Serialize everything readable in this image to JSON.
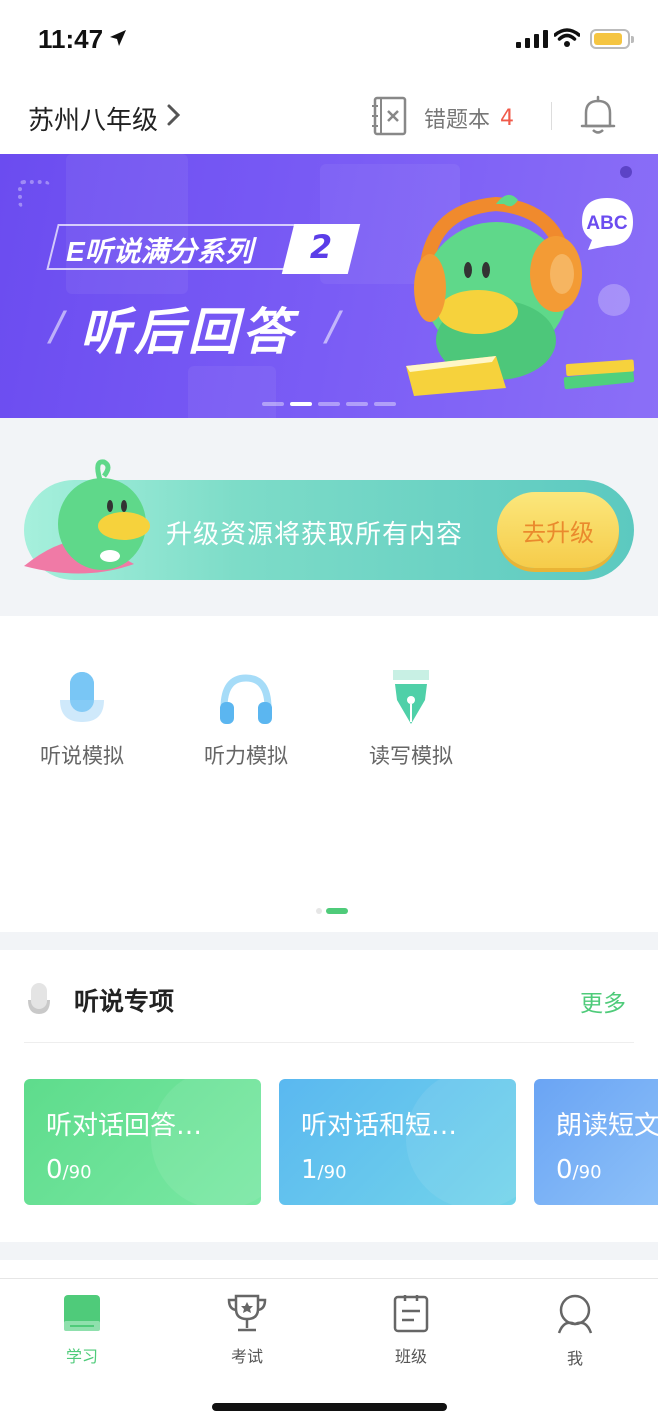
{
  "status_bar": {
    "time": "11:47"
  },
  "header": {
    "grade": "苏州八年级",
    "wrong_book_label": "错题本",
    "wrong_book_count": "4"
  },
  "banner": {
    "series": "E听说满分系列",
    "number": "2",
    "title": "听后回答",
    "badge": "ABC",
    "slides": 5,
    "active_slide": 1
  },
  "upgrade": {
    "text": "升级资源将获取所有内容",
    "button": "去升级"
  },
  "features": [
    {
      "label": "听说模拟",
      "icon": "microphone-icon"
    },
    {
      "label": "听力模拟",
      "icon": "headphones-icon"
    },
    {
      "label": "读写模拟",
      "icon": "pen-nib-icon"
    }
  ],
  "section": {
    "title": "听说专项",
    "more": "更多",
    "cards": [
      {
        "title": "听对话回答…",
        "done": "0",
        "total": "/90",
        "color_from": "#5edc8c",
        "color_to": "#7ae8a4"
      },
      {
        "title": "听对话和短…",
        "done": "1",
        "total": "/90",
        "color_from": "#5ab8f0",
        "color_to": "#72d4ea"
      },
      {
        "title": "朗读短文",
        "done": "0",
        "total": "/90",
        "color_from": "#6aa4f4",
        "color_to": "#8cc0f8"
      }
    ]
  },
  "tabbar": {
    "tabs": [
      {
        "label": "学习",
        "icon": "book-icon",
        "active": true
      },
      {
        "label": "考试",
        "icon": "trophy-icon",
        "active": false
      },
      {
        "label": "班级",
        "icon": "clipboard-icon",
        "active": false
      },
      {
        "label": "我",
        "icon": "user-icon",
        "active": false
      }
    ]
  },
  "colors": {
    "accent": "#4fcb7a",
    "banner": "#6b4cf0",
    "alert": "#f05a4a"
  }
}
